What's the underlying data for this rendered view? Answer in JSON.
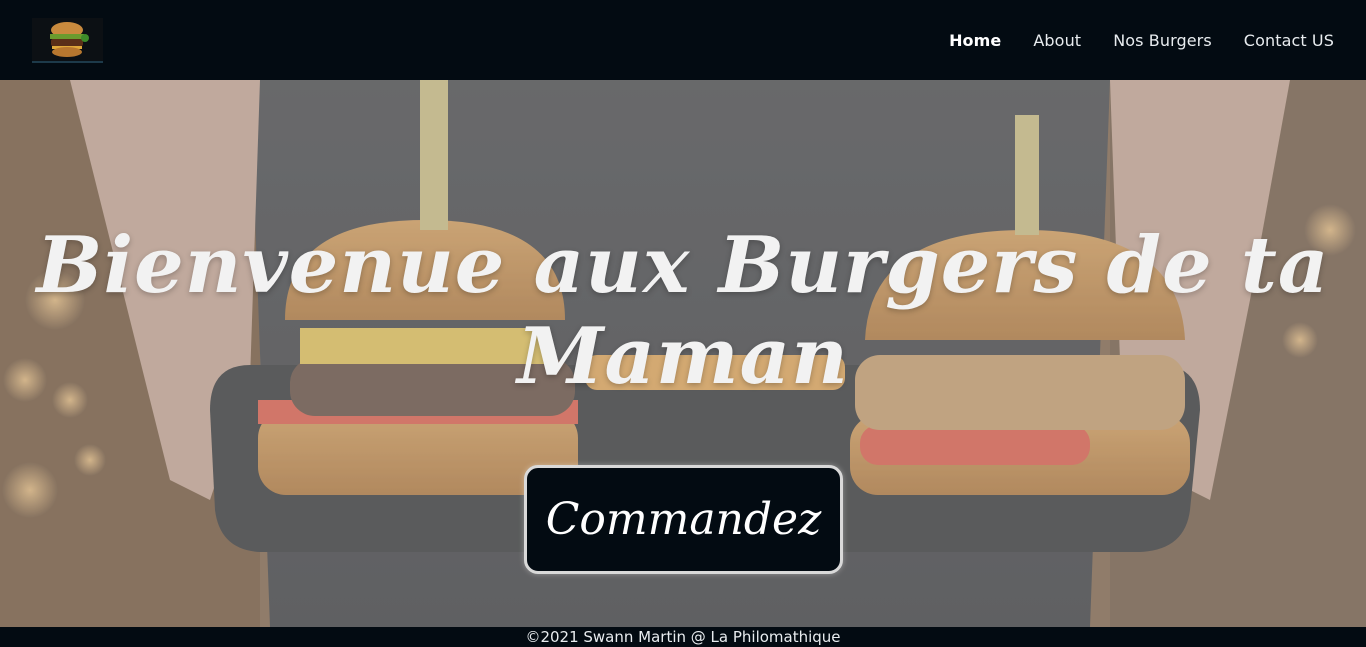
{
  "header": {
    "logo_icon": "burger-logo-icon",
    "nav": [
      {
        "label": "Home",
        "active": true
      },
      {
        "label": "About",
        "active": false
      },
      {
        "label": "Nos Burgers",
        "active": false
      },
      {
        "label": "Contact US",
        "active": false
      }
    ]
  },
  "hero": {
    "title": "Bienvenue aux Burgers de ta Maman",
    "cta_label": "Commandez"
  },
  "footer": {
    "text": "©2021 Swann Martin @ La Philomathique"
  },
  "colors": {
    "header_bg": "#030b12",
    "text_light": "#f2f2f2",
    "button_bg": "#030b12"
  }
}
